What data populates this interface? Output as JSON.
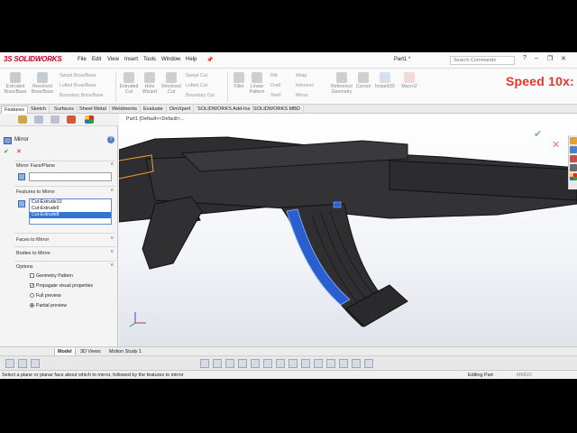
{
  "app": {
    "name": "SOLIDWORKS",
    "doc_title": "Part1 *",
    "search_placeholder": "Search Commands",
    "menu": [
      "File",
      "Edit",
      "View",
      "Insert",
      "Tools",
      "Window",
      "Help"
    ],
    "window_buttons": [
      "?",
      "–",
      "❐",
      "✕"
    ]
  },
  "ribbon": {
    "big": [
      {
        "label": "Extruded Boss/Base"
      },
      {
        "label": "Revolved Boss/Base"
      },
      {
        "label": "Extruded Cut"
      },
      {
        "label": "Hole Wizard"
      },
      {
        "label": "Revolved Cut"
      },
      {
        "label": "Fillet"
      },
      {
        "label": "Linear Pattern"
      },
      {
        "label": "Reference Geometry"
      },
      {
        "label": "Curves"
      },
      {
        "label": "Instant3D"
      },
      {
        "label": "Macro2"
      }
    ],
    "small": [
      "Swept Boss/Base",
      "Lofted Boss/Base",
      "Boundary Boss/Base",
      "Swept Cut",
      "Lofted Cut",
      "Boundary Cut",
      "Rib",
      "Draft",
      "Shell",
      "Wrap",
      "Intersect",
      "Mirror"
    ]
  },
  "overlay": {
    "speed": "Speed 10x:"
  },
  "tabs": [
    "Features",
    "Sketch",
    "Surfaces",
    "Sheet Metal",
    "Weldments",
    "Evaluate",
    "DimXpert",
    "SOLIDWORKS Add-Ins",
    "SOLIDWORKS MBD"
  ],
  "panel": {
    "title": "Mirror",
    "help": "?",
    "ok": "✔",
    "cancel": "✕",
    "sections": {
      "mirror_face": "Mirror Face/Plane",
      "features": "Features to Mirror",
      "faces": "Faces to Mirror",
      "bodies": "Bodies to Mirror",
      "options": "Options"
    },
    "features_list": [
      "Cut-Extrude10",
      "Cut-Extrude9",
      "Cut-Extrude8"
    ],
    "options": {
      "geometry_pattern": "Geometry Pattern",
      "propagate": "Propagate visual properties",
      "full_preview": "Full preview",
      "partial_preview": "Partial preview"
    }
  },
  "viewport": {
    "breadcrumb": "Part1 (Default<<Default>..."
  },
  "bottom_tabs": [
    "Model",
    "3D Views",
    "Motion Study 1"
  ],
  "status": {
    "message": "Select a plane or planar face about which to mirror, followed by the features to mirror",
    "state": "Editing Part",
    "units": "MMGS"
  },
  "colors": {
    "accent_red": "#d0021b",
    "selection_blue": "#3275d3",
    "model_dark": "#2e2e30",
    "highlight_blue": "#2a5fd0"
  }
}
